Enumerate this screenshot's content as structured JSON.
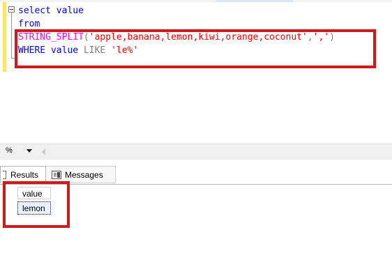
{
  "editor": {
    "lines": [
      {
        "segments": [
          {
            "text": "select",
            "cls": "kw"
          },
          {
            "text": " ",
            "cls": "ident"
          },
          {
            "text": "value",
            "cls": "kw"
          }
        ]
      },
      {
        "segments": [
          {
            "text": "from",
            "cls": "kw"
          }
        ]
      },
      {
        "segments": [
          {
            "text": "STRING_SPLIT",
            "cls": "fn"
          },
          {
            "text": "(",
            "cls": "gray"
          },
          {
            "text": "'apple,banana,lemon,kiwi,orange,coconut'",
            "cls": "str"
          },
          {
            "text": ",",
            "cls": "gray"
          },
          {
            "text": "','",
            "cls": "str"
          },
          {
            "text": ")",
            "cls": "gray"
          }
        ]
      },
      {
        "segments": [
          {
            "text": "WHERE",
            "cls": "kw"
          },
          {
            "text": " ",
            "cls": "ident"
          },
          {
            "text": "value",
            "cls": "kw"
          },
          {
            "text": " ",
            "cls": "ident"
          },
          {
            "text": "LIKE",
            "cls": "gray"
          },
          {
            "text": " ",
            "cls": "ident"
          },
          {
            "text": "'le%'",
            "cls": "str"
          }
        ]
      }
    ]
  },
  "zoom": {
    "value": "%"
  },
  "tabs": {
    "results_label": "Results",
    "messages_label": "Messages"
  },
  "results": {
    "column_header": "value",
    "rows": [
      "lemon"
    ]
  },
  "colors": {
    "keyword": "#0000ff",
    "function": "#ff00ff",
    "string": "#ff0000",
    "operator": "#808080",
    "highlight": "#d0191b"
  }
}
